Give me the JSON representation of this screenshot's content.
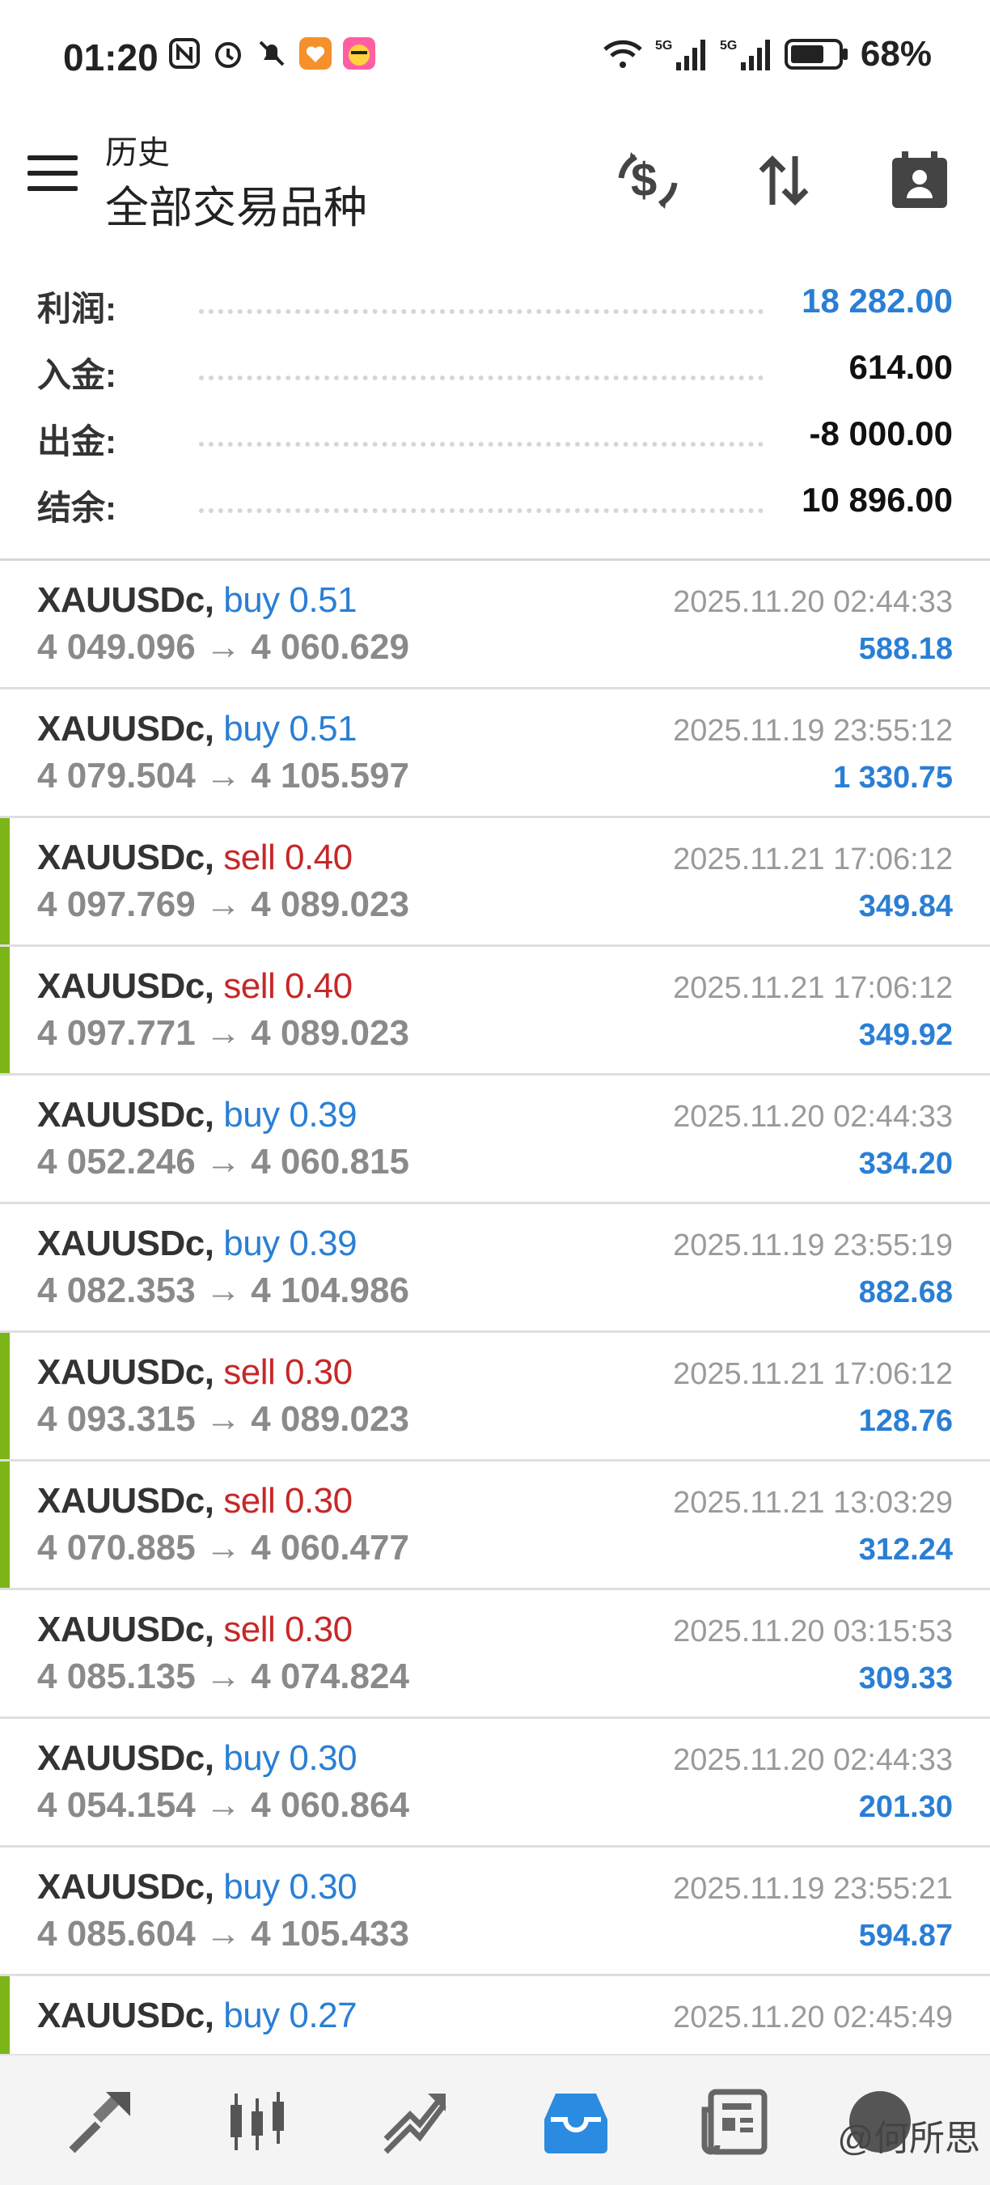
{
  "status_bar": {
    "time": "01:20",
    "battery": "68%"
  },
  "header": {
    "subtitle": "历史",
    "title": "全部交易品种"
  },
  "summary": [
    {
      "label": "利润:",
      "value": "18 282.00",
      "color": "#2a7fd4"
    },
    {
      "label": "入金:",
      "value": "614.00",
      "color": "#111111"
    },
    {
      "label": "出金:",
      "value": "-8 000.00",
      "color": "#111111"
    },
    {
      "label": "结余:",
      "value": "10 896.00",
      "color": "#111111"
    }
  ],
  "trades": [
    {
      "symbol": "XAUUSDc,",
      "side": "buy 0.51",
      "type": "buy",
      "prices": "4 049.096 → 4 060.629",
      "time": "2025.11.20 02:44:33",
      "profit": "588.18",
      "marker": false
    },
    {
      "symbol": "XAUUSDc,",
      "side": "buy 0.51",
      "type": "buy",
      "prices": "4 079.504 → 4 105.597",
      "time": "2025.11.19 23:55:12",
      "profit": "1 330.75",
      "marker": false
    },
    {
      "symbol": "XAUUSDc,",
      "side": "sell 0.40",
      "type": "sell",
      "prices": "4 097.769 → 4 089.023",
      "time": "2025.11.21 17:06:12",
      "profit": "349.84",
      "marker": true
    },
    {
      "symbol": "XAUUSDc,",
      "side": "sell 0.40",
      "type": "sell",
      "prices": "4 097.771 → 4 089.023",
      "time": "2025.11.21 17:06:12",
      "profit": "349.92",
      "marker": true
    },
    {
      "symbol": "XAUUSDc,",
      "side": "buy 0.39",
      "type": "buy",
      "prices": "4 052.246 → 4 060.815",
      "time": "2025.11.20 02:44:33",
      "profit": "334.20",
      "marker": false
    },
    {
      "symbol": "XAUUSDc,",
      "side": "buy 0.39",
      "type": "buy",
      "prices": "4 082.353 → 4 104.986",
      "time": "2025.11.19 23:55:19",
      "profit": "882.68",
      "marker": false
    },
    {
      "symbol": "XAUUSDc,",
      "side": "sell 0.30",
      "type": "sell",
      "prices": "4 093.315 → 4 089.023",
      "time": "2025.11.21 17:06:12",
      "profit": "128.76",
      "marker": true
    },
    {
      "symbol": "XAUUSDc,",
      "side": "sell 0.30",
      "type": "sell",
      "prices": "4 070.885 → 4 060.477",
      "time": "2025.11.21 13:03:29",
      "profit": "312.24",
      "marker": true
    },
    {
      "symbol": "XAUUSDc,",
      "side": "sell 0.30",
      "type": "sell",
      "prices": "4 085.135 → 4 074.824",
      "time": "2025.11.20 03:15:53",
      "profit": "309.33",
      "marker": false
    },
    {
      "symbol": "XAUUSDc,",
      "side": "buy 0.30",
      "type": "buy",
      "prices": "4 054.154 → 4 060.864",
      "time": "2025.11.20 02:44:33",
      "profit": "201.30",
      "marker": false
    },
    {
      "symbol": "XAUUSDc,",
      "side": "buy 0.30",
      "type": "buy",
      "prices": "4 085.604 → 4 105.433",
      "time": "2025.11.19 23:55:21",
      "profit": "594.87",
      "marker": false
    },
    {
      "symbol": "XAUUSDc,",
      "side": "buy 0.27",
      "type": "buy",
      "prices": "",
      "time": "2025.11.20 02:45:49",
      "profit": "",
      "marker": true
    }
  ],
  "bottom_nav": {
    "items": [
      {
        "icon": "quotes-icon"
      },
      {
        "icon": "chart-icon"
      },
      {
        "icon": "trade-icon"
      },
      {
        "icon": "history-icon",
        "active": true
      },
      {
        "icon": "news-icon"
      },
      {
        "icon": "messages-icon"
      }
    ],
    "watermark": "@何所思"
  },
  "colors": {
    "accent_blue": "#2a7fd4",
    "sell_red": "#c62828",
    "marker_green": "#7cb518"
  }
}
